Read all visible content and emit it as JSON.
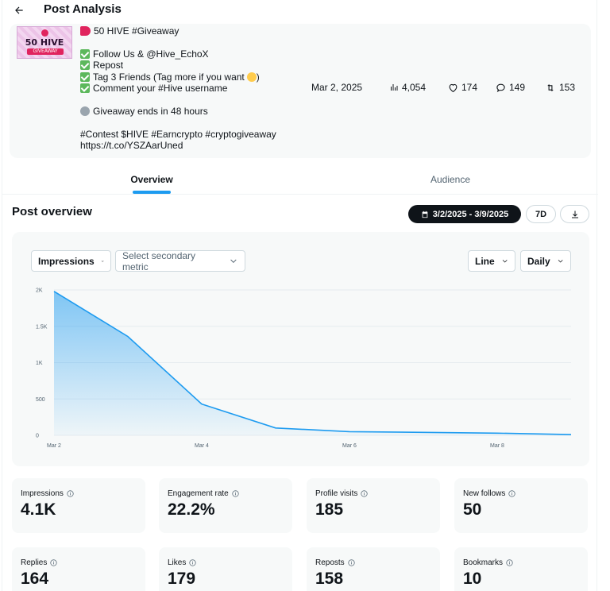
{
  "header": {
    "title": "Post Analysis"
  },
  "post": {
    "thumbnail": {
      "title": "50 HIVE",
      "subtitle": "GIVEAWAY"
    },
    "lines": [
      {
        "emoji": "horn",
        "text": "50 HIVE #Giveaway"
      },
      {
        "gap": true
      },
      {
        "emoji": "check",
        "text": "Follow Us & @Hive_EchoX"
      },
      {
        "emoji": "check",
        "text": "Repost"
      },
      {
        "emoji": "check",
        "text": "Tag 3 Friends (Tag more if you want",
        "trail": "heart-eyes",
        "after": ")"
      },
      {
        "emoji": "check",
        "text": "Comment your #Hive username"
      },
      {
        "gap": true
      },
      {
        "emoji": "clock",
        "text": "Giveaway ends in 48 hours"
      },
      {
        "gap": true
      },
      {
        "text": "#Contest $HIVE #Earncrypto #cryptogiveaway"
      },
      {
        "text": "https://t.co/YSZAarUned"
      }
    ],
    "date": "Mar 2, 2025",
    "views": "4,054",
    "likes": "174",
    "replies": "149",
    "reposts": "153"
  },
  "tabs": [
    {
      "label": "Overview",
      "active": true
    },
    {
      "label": "Audience",
      "active": false
    }
  ],
  "overview": {
    "title": "Post overview",
    "date_range": "3/2/2025 - 3/9/2025",
    "range_preset": "7D",
    "primary_metric": "Impressions",
    "secondary_metric_placeholder": "Select secondary metric",
    "chart_style": "Line",
    "granularity": "Daily"
  },
  "chart_data": {
    "type": "area",
    "x": [
      "Mar 2",
      "Mar 3",
      "Mar 4",
      "Mar 5",
      "Mar 6",
      "Mar 7",
      "Mar 8",
      "Mar 9"
    ],
    "values": [
      1980,
      1360,
      430,
      100,
      50,
      40,
      30,
      10
    ],
    "x_tick_labels": [
      "Mar 2",
      "Mar 4",
      "Mar 6",
      "Mar 8"
    ],
    "y_ticks": [
      0,
      500,
      1000,
      1500,
      2000
    ],
    "y_tick_labels": [
      "0",
      "500",
      "1K",
      "1.5K",
      "2K"
    ],
    "ylim": [
      0,
      2000
    ],
    "grid": true,
    "color": "#1d9bf0"
  },
  "metrics": [
    {
      "label": "Impressions",
      "value": "4.1K"
    },
    {
      "label": "Engagement rate",
      "value": "22.2%"
    },
    {
      "label": "Profile visits",
      "value": "185"
    },
    {
      "label": "New follows",
      "value": "50"
    },
    {
      "label": "Replies",
      "value": "164"
    },
    {
      "label": "Likes",
      "value": "179"
    },
    {
      "label": "Reposts",
      "value": "158"
    },
    {
      "label": "Bookmarks",
      "value": "10"
    }
  ],
  "colors": {
    "accent": "#1d9bf0",
    "text": "#0f1419",
    "muted": "#536471",
    "card": "#f7f9f9"
  }
}
